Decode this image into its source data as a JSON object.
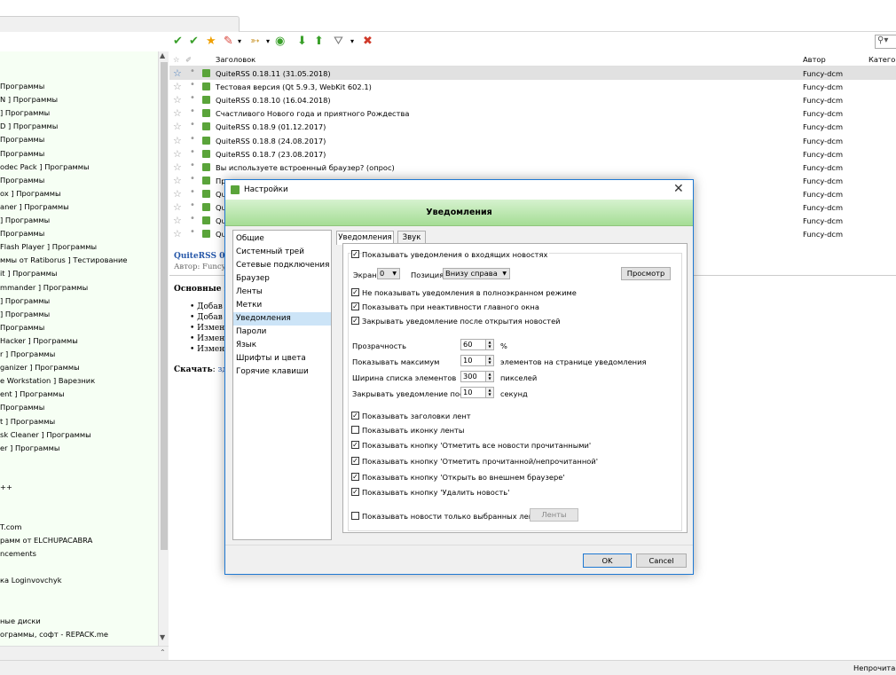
{
  "toolbar": {
    "search_icon": "user-search-icon"
  },
  "tree": {
    "items": [
      " Программы",
      "N ] Программы",
      "] Программы",
      "D ] Программы",
      " Программы",
      " Программы",
      "odec Pack ] Программы",
      " Программы",
      "ox ] Программы",
      "aner ] Программы",
      "] Программы",
      " Программы",
      "Flash Player ] Программы",
      "ммы от Ratiborus ] Тестирование",
      "it ] Программы",
      "mmander ] Программы",
      "] Программы",
      "] Программы",
      " Программы",
      " Hacker ] Программы",
      "r ] Программы",
      "ganizer ] Программы",
      "e Workstation ] Варезник",
      "ent ] Программы",
      "Программы",
      "t ] Программы",
      "sk Cleaner ] Программы",
      "er ] Программы"
    ],
    "lower_items": [
      "++",
      "T.com",
      "рамм от ELCHUPACABRA",
      "ncements",
      "ка Loginvovchyk",
      "ные диски",
      "ограммы, софт - REPACK.me"
    ]
  },
  "list": {
    "headers": {
      "title": "Заголовок",
      "author": "Автор",
      "category": "Категор"
    },
    "rows": [
      {
        "title": "QuiteRSS 0.18.11 (31.05.2018)",
        "author": "Funcy-dcm",
        "selected": true,
        "starred": true
      },
      {
        "title": "Тестовая версия (Qt 5.9.3, WebKit 602.1)",
        "author": "Funcy-dcm"
      },
      {
        "title": "QuiteRSS 0.18.10 (16.04.2018)",
        "author": "Funcy-dcm"
      },
      {
        "title": "Счастливого Нового года и приятного Рождества",
        "author": "Funcy-dcm"
      },
      {
        "title": "QuiteRSS 0.18.9 (01.12.2017)",
        "author": "Funcy-dcm"
      },
      {
        "title": "QuiteRSS 0.18.8 (24.08.2017)",
        "author": "Funcy-dcm"
      },
      {
        "title": "QuiteRSS 0.18.7 (23.08.2017)",
        "author": "Funcy-dcm"
      },
      {
        "title": "Вы используете встроенный браузер? (опрос)",
        "author": "Funcy-dcm"
      },
      {
        "title": "Пр",
        "author": "Funcy-dcm"
      },
      {
        "title": "Qu",
        "author": "Funcy-dcm"
      },
      {
        "title": "Qu",
        "author": "Funcy-dcm"
      },
      {
        "title": "Qu",
        "author": "Funcy-dcm"
      },
      {
        "title": "Qu",
        "author": "Funcy-dcm"
      }
    ]
  },
  "preview": {
    "title": "QuiteRSS 0.1",
    "author": "Автор: Funcy",
    "heading": "Основные из",
    "bullets": [
      "Добав",
      "Добав",
      "Измен",
      "Измен",
      "Измен"
    ],
    "download_label": "Скачать",
    "download_link": "здес"
  },
  "status": {
    "text": "Непрочитан"
  },
  "dialog": {
    "title": "Настройки",
    "banner": "Уведомления",
    "close_icon": "close-icon",
    "categories": [
      "Общие",
      "Системный трей",
      "Сетевые подключения",
      "Браузер",
      "Ленты",
      "Метки",
      "Уведомления",
      "Пароли",
      "Язык",
      "Шрифты и цвета",
      "Горячие клавиши"
    ],
    "selected_category": "Уведомления",
    "tabs": [
      "Уведомления",
      "Звук"
    ],
    "group_title": "Показывать уведомления о входящих новостях",
    "screen_label": "Экран",
    "screen_value": "0",
    "position_label": "Позиция",
    "position_value": "Внизу справа",
    "preview_button": "Просмотр",
    "opt_fullscreen": "Не показывать уведомления в полноэкранном режиме",
    "opt_inactive": "Показывать при неактивности главного окна",
    "opt_close_after": "Закрывать уведомление после открытия новостей",
    "transparency_label": "Прозрачность",
    "transparency_value": "60",
    "transparency_unit": "%",
    "show_max_label": "Показывать максимум",
    "show_max_value": "10",
    "show_max_unit": "элементов на странице уведомления",
    "width_label": "Ширина списка элементов",
    "width_value": "300",
    "width_unit": "пикселей",
    "close_after_label": "Закрывать уведомление после",
    "close_after_value": "10",
    "close_after_unit": "секунд",
    "opt_feed_titles": "Показывать заголовки лент",
    "opt_feed_icon": "Показывать иконку ленты",
    "opt_btn_mark_all": "Показывать кнопку 'Отметить все новости прочитанными'",
    "opt_btn_mark_read": "Показывать кнопку 'Отметить прочитанной/непрочитанной'",
    "opt_btn_open_browser": "Показывать кнопку 'Открыть во внешнем браузере'",
    "opt_btn_delete": "Показывать кнопку 'Удалить новость'",
    "opt_selected_feeds": "Показывать новости только выбранных лент:",
    "feeds_button": "Ленты",
    "ok_button": "OK",
    "cancel_button": "Cancel",
    "checkbox_states": {
      "group": true,
      "fullscreen": true,
      "inactive": true,
      "close_after": true,
      "feed_titles": true,
      "feed_icon": false,
      "btn_mark_all": true,
      "btn_mark_read": true,
      "btn_open_browser": true,
      "btn_delete": true,
      "selected_feeds": false
    }
  },
  "colors": {
    "accent_green": "#5aa43a",
    "selection_blue": "#cce4f7",
    "window_border": "#1e78d2",
    "link_blue": "#2657a8"
  }
}
